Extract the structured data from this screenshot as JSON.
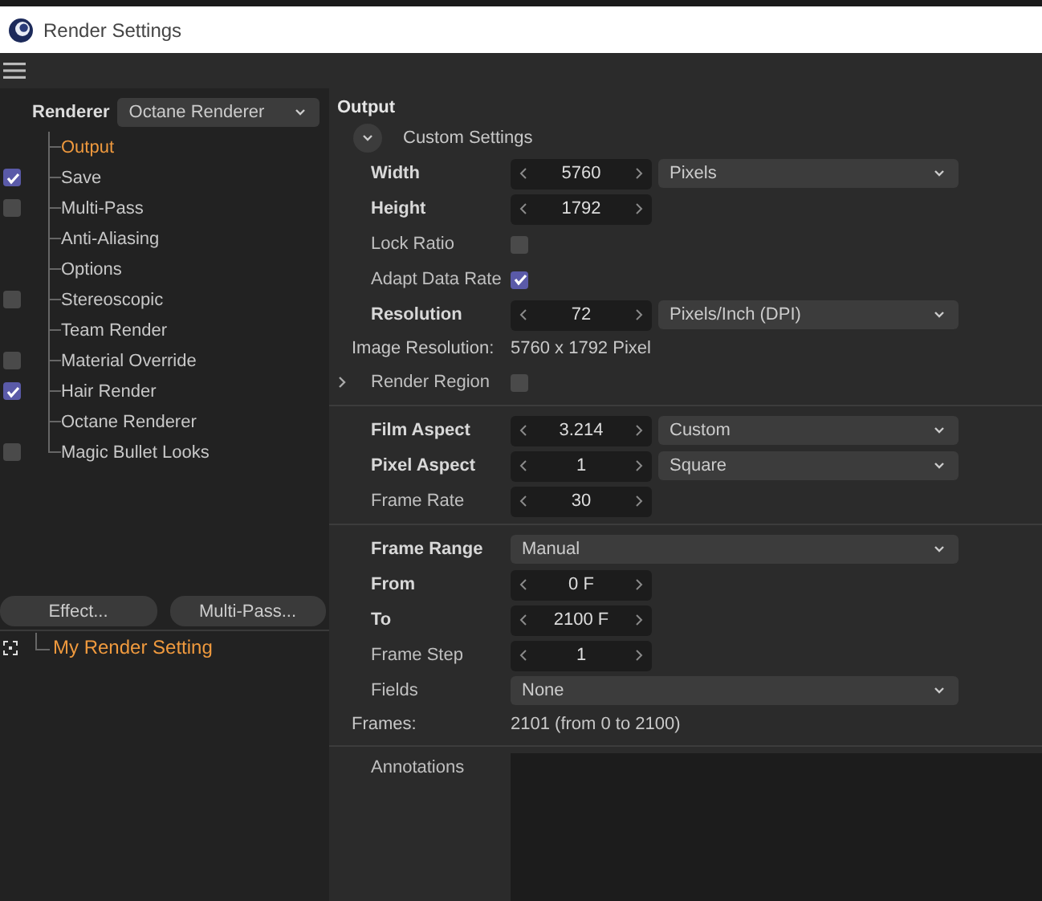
{
  "window": {
    "title": "Render Settings"
  },
  "renderer": {
    "label": "Renderer",
    "value": "Octane Renderer"
  },
  "tree": {
    "items": [
      {
        "label": "Output",
        "kind": "plain",
        "selected": true
      },
      {
        "label": "Save",
        "kind": "checkbox",
        "checked": true,
        "selected": false
      },
      {
        "label": "Multi-Pass",
        "kind": "checkbox",
        "checked": false,
        "selected": false
      },
      {
        "label": "Anti-Aliasing",
        "kind": "plain",
        "selected": false
      },
      {
        "label": "Options",
        "kind": "plain",
        "selected": false
      },
      {
        "label": "Stereoscopic",
        "kind": "checkbox",
        "checked": false,
        "selected": false
      },
      {
        "label": "Team Render",
        "kind": "plain",
        "selected": false
      },
      {
        "label": "Material Override",
        "kind": "checkbox",
        "checked": false,
        "selected": false
      },
      {
        "label": "Hair Render",
        "kind": "checkbox",
        "checked": true,
        "selected": false
      },
      {
        "label": "Octane Renderer",
        "kind": "plain",
        "selected": false
      },
      {
        "label": "Magic Bullet Looks",
        "kind": "checkbox",
        "checked": false,
        "selected": false
      }
    ]
  },
  "buttons": [
    "Effect...",
    "Multi-Pass..."
  ],
  "render_setting": {
    "label": "My Render Setting",
    "selected": true
  },
  "panel": {
    "heading": "Output",
    "preset": {
      "label": "Custom Settings",
      "expanded": true
    },
    "sections": [
      [
        {
          "kind": "spinner",
          "label": "Width",
          "bold": true,
          "value": "5760",
          "unit": "Pixels"
        },
        {
          "kind": "spinner",
          "label": "Height",
          "bold": true,
          "value": "1792"
        },
        {
          "kind": "check",
          "label": "Lock Ratio",
          "checked": false
        },
        {
          "kind": "check",
          "label": "Adapt Data Rate",
          "checked": true
        },
        {
          "kind": "spinner",
          "label": "Resolution",
          "bold": true,
          "value": "72",
          "unit": "Pixels/Inch (DPI)"
        },
        {
          "kind": "info",
          "label": "Image Resolution:",
          "value": "5760 x 1792 Pixel"
        },
        {
          "kind": "expander",
          "label": "Render Region",
          "checked": false,
          "expanded": false
        }
      ],
      [
        {
          "kind": "spinner",
          "label": "Film Aspect",
          "bold": true,
          "value": "3.214",
          "unit": "Custom"
        },
        {
          "kind": "spinner",
          "label": "Pixel Aspect",
          "bold": true,
          "value": "1",
          "unit": "Square"
        },
        {
          "kind": "spinner",
          "label": "Frame Rate",
          "bold": false,
          "value": "30"
        }
      ],
      [
        {
          "kind": "dropdown",
          "label": "Frame Range",
          "bold": true,
          "value": "Manual"
        },
        {
          "kind": "spinner",
          "label": "From",
          "bold": true,
          "value": "0 F"
        },
        {
          "kind": "spinner",
          "label": "To",
          "bold": true,
          "value": "2100 F"
        },
        {
          "kind": "spinner",
          "label": "Frame Step",
          "bold": false,
          "value": "1"
        },
        {
          "kind": "dropdown",
          "label": "Fields",
          "bold": false,
          "value": "None"
        },
        {
          "kind": "info",
          "label": "Frames:",
          "value": "2101 (from 0 to 2100)"
        }
      ]
    ],
    "annotations": {
      "label": "Annotations"
    }
  }
}
